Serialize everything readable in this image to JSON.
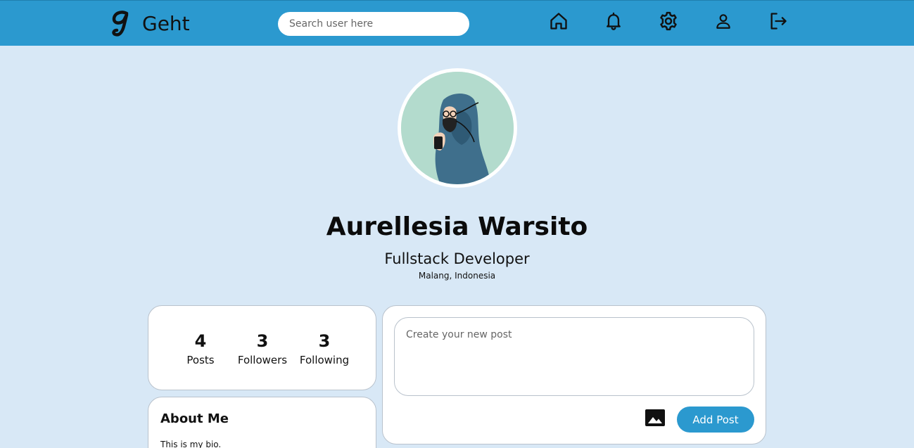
{
  "brand": {
    "name": "Geht",
    "logo_letter": "g"
  },
  "search": {
    "placeholder": "Search user here",
    "value": ""
  },
  "nav": {
    "icons": [
      "home-icon",
      "bell-icon",
      "gear-icon",
      "user-icon",
      "logout-icon"
    ]
  },
  "profile": {
    "name": "Aurellesia Warsito",
    "role": "Fullstack Developer",
    "location": "Malang, Indonesia"
  },
  "stats": [
    {
      "value": "4",
      "label": "Posts"
    },
    {
      "value": "3",
      "label": "Followers"
    },
    {
      "value": "3",
      "label": "Following"
    }
  ],
  "about": {
    "title": "About Me",
    "bio": "This is my bio."
  },
  "composer": {
    "placeholder": "Create your new post",
    "button_label": "Add Post"
  },
  "colors": {
    "navbar": "#2b99cf",
    "page_bg": "#d8e8f6",
    "accent": "#2b99cf",
    "avatar_bg": "#b3dbcd"
  }
}
